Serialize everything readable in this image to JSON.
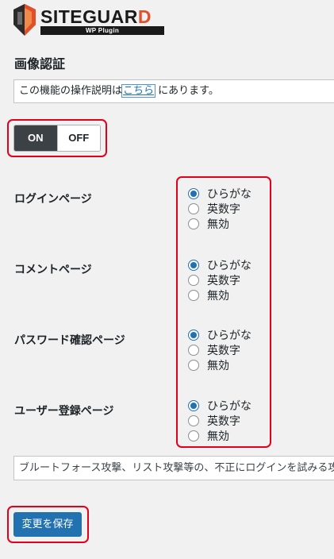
{
  "logo": {
    "name": "SITEGUAR",
    "name_accent": "D",
    "subtitle": "WP Plugin"
  },
  "page": {
    "title": "画像認証"
  },
  "info": {
    "before_link": "この機能の操作説明は",
    "link": "こちら",
    "after_link": "にあります。"
  },
  "toggle": {
    "on_label": "ON",
    "off_label": "OFF",
    "selected": "ON"
  },
  "settings": [
    {
      "label": "ログインページ",
      "options": [
        "ひらがな",
        "英数字",
        "無効"
      ],
      "selected": 0
    },
    {
      "label": "コメントページ",
      "options": [
        "ひらがな",
        "英数字",
        "無効"
      ],
      "selected": 0
    },
    {
      "label": "パスワード確認ページ",
      "options": [
        "ひらがな",
        "英数字",
        "無効"
      ],
      "selected": 0
    },
    {
      "label": "ユーザー登録ページ",
      "options": [
        "ひらがな",
        "英数字",
        "無効"
      ],
      "selected": 0
    }
  ],
  "description": "ブルートフォース攻撃、リスト攻撃等の、不正にログインを試みる攻",
  "save_button": "変更を保存",
  "colors": {
    "accent": "#2271b1",
    "highlight": "#e4001b",
    "toggle_on": "#3c4146"
  }
}
